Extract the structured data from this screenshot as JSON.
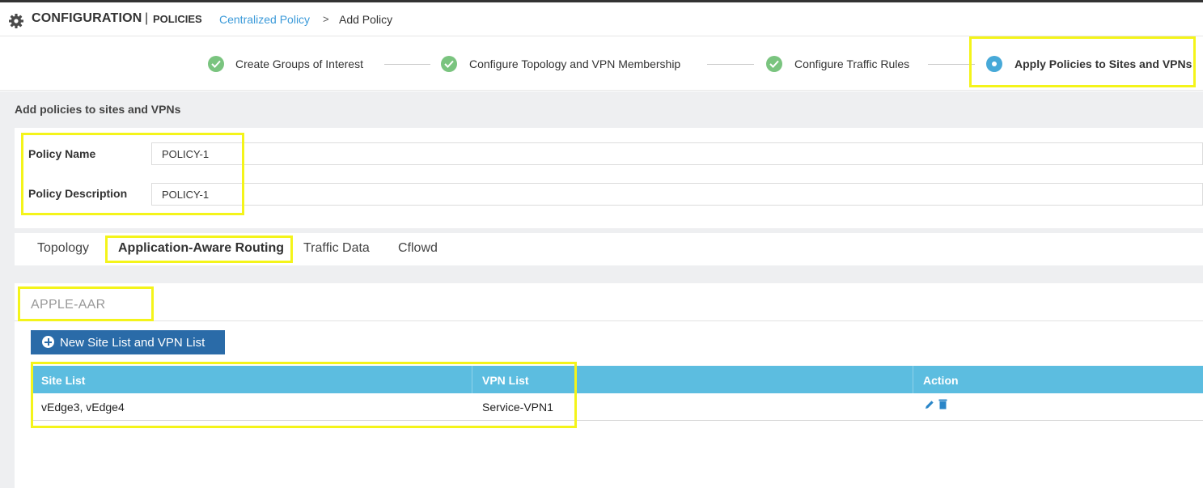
{
  "header": {
    "title": "CONFIGURATION",
    "separator": "|",
    "subtitle": "POLICIES",
    "breadcrumb_link": "Centralized Policy",
    "breadcrumb_arrow": ">",
    "breadcrumb_current": "Add Policy"
  },
  "steps": [
    {
      "label": "Create Groups of Interest",
      "status": "complete"
    },
    {
      "label": "Configure Topology and VPN Membership",
      "status": "complete"
    },
    {
      "label": "Configure Traffic Rules",
      "status": "complete"
    },
    {
      "label": "Apply Policies to Sites and VPNs",
      "status": "active"
    }
  ],
  "section_title": "Add policies to sites and VPNs",
  "form": {
    "policy_name_label": "Policy Name",
    "policy_name_value": "POLICY-1",
    "policy_description_label": "Policy Description",
    "policy_description_value": "POLICY-1"
  },
  "tabs": [
    {
      "label": "Topology",
      "active": false
    },
    {
      "label": "Application-Aware Routing",
      "active": true
    },
    {
      "label": "Traffic Data",
      "active": false
    },
    {
      "label": "Cflowd",
      "active": false
    }
  ],
  "policy_block": {
    "title": "APPLE-AAR",
    "new_button_label": "New Site List and VPN List",
    "columns": [
      "Site List",
      "VPN List",
      "Action"
    ],
    "rows": [
      {
        "site_list": "vEdge3, vEdge4",
        "vpn_list": "Service-VPN1"
      }
    ]
  },
  "colors": {
    "accent_blue": "#2a6ba8",
    "table_header": "#5cbde0",
    "link": "#3b9ad9",
    "success": "#7ac47f",
    "highlight": "#f4f41a"
  },
  "icons": [
    "gear-icon",
    "check-icon",
    "active-step-icon",
    "plus-circle-icon",
    "edit-icon",
    "delete-icon"
  ]
}
